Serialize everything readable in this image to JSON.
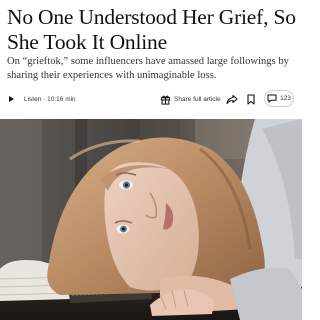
{
  "article": {
    "headline": "No One Understood Her Grief, So She Took It Online",
    "summary": "On “grieftok,” some influencers have amassed large followings by sharing their experiences with unimaginable loss."
  },
  "toolbar": {
    "listen_label": "Listen · 10:16 min",
    "share_full_article_label": "Share full article",
    "comments_count": "123",
    "icons": {
      "play": "play-icon",
      "gift": "gift-icon",
      "share": "share-arrow-icon",
      "bookmark": "bookmark-icon",
      "comment": "comment-bubble-icon"
    }
  },
  "colors": {
    "text": "#121212",
    "summary_text": "#363636",
    "pill_border": "#d0d0d0"
  }
}
